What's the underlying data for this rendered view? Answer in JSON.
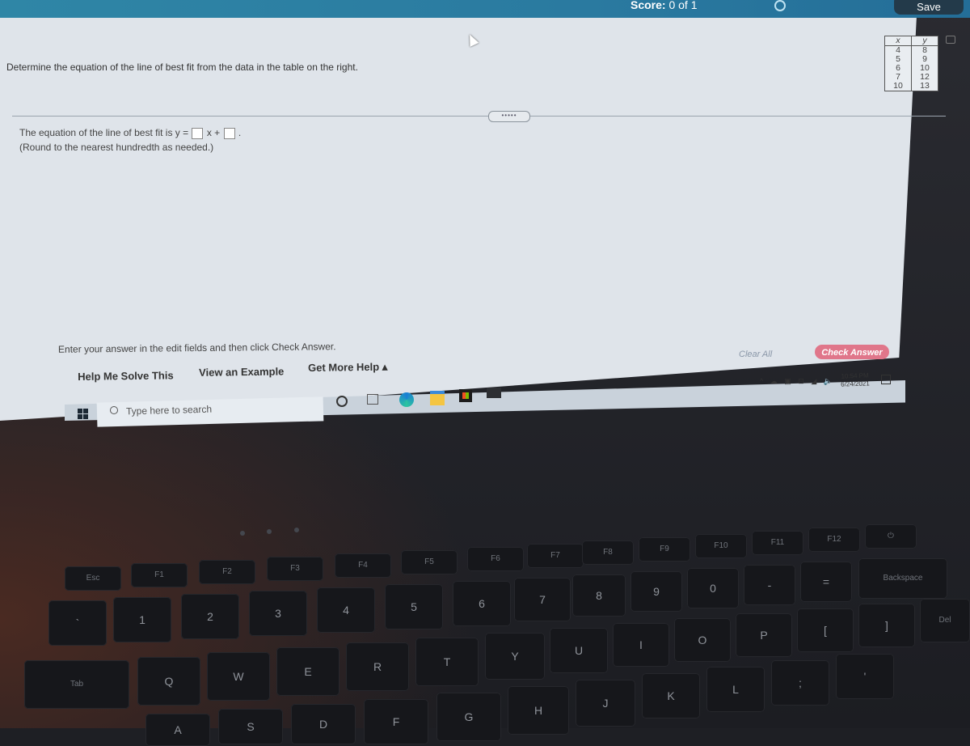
{
  "header": {
    "score_label": "Score:",
    "score_value": "0 of 1",
    "save_label": "Save"
  },
  "question": {
    "prompt": "Determine the equation of the line of best fit from the data in the table on the right.",
    "answer_prefix": "The equation of the line of best fit is y =",
    "answer_middle": "x +",
    "answer_suffix": ".",
    "slope_value": "",
    "intercept_value": "",
    "round_note": "(Round to the nearest hundredth as needed.)",
    "expand_label": "•••••"
  },
  "table": {
    "headers": [
      "x",
      "y"
    ],
    "rows": [
      [
        "4",
        "8"
      ],
      [
        "5",
        "9"
      ],
      [
        "6",
        "10"
      ],
      [
        "7",
        "12"
      ],
      [
        "10",
        "13"
      ]
    ]
  },
  "footer": {
    "instruction": "Enter your answer in the edit fields and then click Check Answer.",
    "help_links": [
      "Help Me Solve This",
      "View an Example",
      "Get More Help ▴"
    ],
    "clear_all": "Clear All",
    "check_answer": "Check Answer"
  },
  "taskbar": {
    "search_placeholder": "Type here to search",
    "pinned_icons": [
      "cortana-icon",
      "task-view-icon",
      "edge-icon",
      "file-explorer-icon",
      "store-icon",
      "mail-icon"
    ],
    "tray_icons": [
      "chevron-up-icon",
      "onedrive-icon",
      "app-icon",
      "network-icon",
      "wifi-icon",
      "volume-icon"
    ],
    "time": "10:54 PM",
    "date": "6/24/2021"
  },
  "keyboard": {
    "fn_row": [
      "Esc",
      "F1",
      "F2",
      "F3",
      "F4",
      "F5",
      "F6",
      "F7",
      "F8",
      "F9",
      "F10",
      "F11",
      "F12"
    ],
    "number_row": [
      "`",
      "1",
      "2",
      "3",
      "4",
      "5",
      "6",
      "7",
      "8",
      "9",
      "0",
      "-",
      "=",
      "Backspace"
    ],
    "number_row_shift": [
      "~",
      "!",
      "@",
      "#",
      "$",
      "%",
      "^",
      "&",
      "*",
      "(",
      ")",
      "_",
      "+",
      ""
    ],
    "top_row": [
      "Tab",
      "Q",
      "W",
      "E",
      "R",
      "T",
      "Y",
      "U",
      "I",
      "O",
      "P",
      "[",
      "]",
      "Del"
    ],
    "home_row": [
      "A",
      "S",
      "D",
      "F",
      "G",
      "H",
      "J",
      "K",
      "L",
      ";",
      "'"
    ]
  }
}
